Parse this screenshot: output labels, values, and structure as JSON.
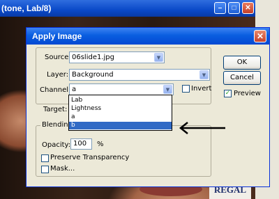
{
  "photo_window": {
    "title": "(tone, Lab/8)",
    "sign_text": "REGAL"
  },
  "dialog": {
    "title": "Apply Image",
    "source": {
      "label": "Source:",
      "value": "06slide1.jpg"
    },
    "layer": {
      "label": "Layer:",
      "value": "Background"
    },
    "channel": {
      "label": "Channel:",
      "value": "a",
      "invert_label": "Invert",
      "invert_checked": false
    },
    "target_label": "Target:",
    "blending_label": "Blending",
    "opacity": {
      "label": "Opacity:",
      "value": "100",
      "unit": "%"
    },
    "preserve_transparency_label": "Preserve Transparency",
    "mask_label": "Mask...",
    "ok_label": "OK",
    "cancel_label": "Cancel",
    "preview": {
      "label": "Preview",
      "checked": true
    }
  },
  "channel_dropdown": {
    "options": [
      "Lab",
      "Lightness",
      "a",
      "b"
    ],
    "selected_index": 3
  },
  "colors": {
    "title_blue": "#0a5ee0",
    "selection_blue": "#316ac5",
    "dialog_bg": "#ece9d8"
  }
}
